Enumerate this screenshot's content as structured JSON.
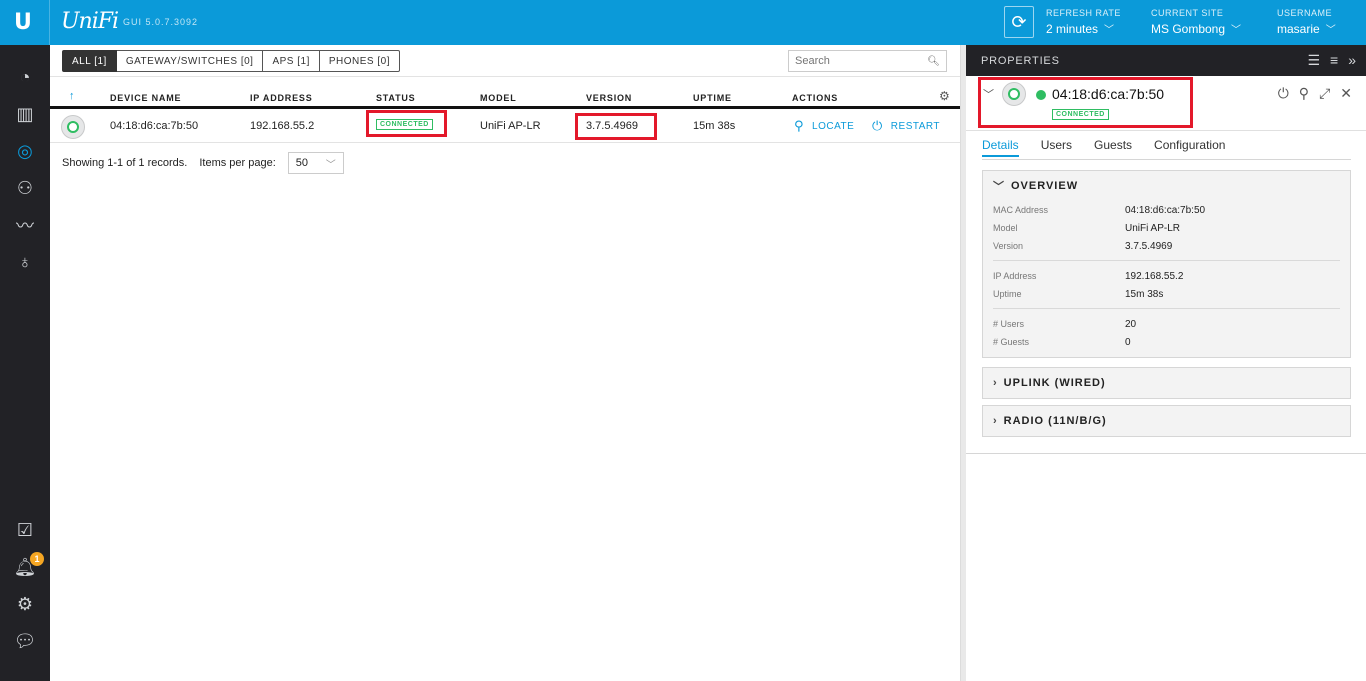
{
  "header": {
    "brand": "UniFi",
    "gui_version": "GUI 5.0.7.3092",
    "refresh_rate_label": "REFRESH RATE",
    "refresh_rate_value": "2 minutes",
    "current_site_label": "CURRENT SITE",
    "current_site_value": "MS Gombong",
    "username_label": "USERNAME",
    "username_value": "masarie"
  },
  "nav": {
    "alerts_badge": "1"
  },
  "filters": [
    {
      "label": "ALL [1]",
      "active": true
    },
    {
      "label": "GATEWAY/SWITCHES [0]",
      "active": false
    },
    {
      "label": "APS [1]",
      "active": false
    },
    {
      "label": "PHONES [0]",
      "active": false
    }
  ],
  "search": {
    "placeholder": "Search"
  },
  "table": {
    "columns": [
      "DEVICE NAME",
      "IP ADDRESS",
      "STATUS",
      "MODEL",
      "VERSION",
      "UPTIME",
      "ACTIONS"
    ],
    "rows": [
      {
        "device_name": "04:18:d6:ca:7b:50",
        "ip": "192.168.55.2",
        "status": "CONNECTED",
        "model": "UniFi AP-LR",
        "version": "3.7.5.4969",
        "uptime": "15m 38s",
        "locate": "LOCATE",
        "restart": "RESTART"
      }
    ]
  },
  "footer": {
    "showing": "Showing 1-1 of 1 records.",
    "items_per_page_label": "Items per page:",
    "items_per_page_value": "50"
  },
  "properties": {
    "title": "PROPERTIES",
    "device_name": "04:18:d6:ca:7b:50",
    "status": "CONNECTED",
    "tabs": [
      "Details",
      "Users",
      "Guests",
      "Configuration"
    ],
    "overview_title": "OVERVIEW",
    "overview": {
      "mac_label": "MAC Address",
      "mac": "04:18:d6:ca:7b:50",
      "model_label": "Model",
      "model": "UniFi AP-LR",
      "version_label": "Version",
      "version": "3.7.5.4969",
      "ip_label": "IP Address",
      "ip": "192.168.55.2",
      "uptime_label": "Uptime",
      "uptime": "15m 38s",
      "users_label": "# Users",
      "users": "20",
      "guests_label": "# Guests",
      "guests": "0"
    },
    "uplink_title": "UPLINK (WIRED)",
    "radio_title": "RADIO (11N/B/G)"
  },
  "colors": {
    "accent": "#0b9ad9",
    "connected": "#2fbd62",
    "highlight": "#e3182a",
    "nav_bg": "#222226"
  }
}
